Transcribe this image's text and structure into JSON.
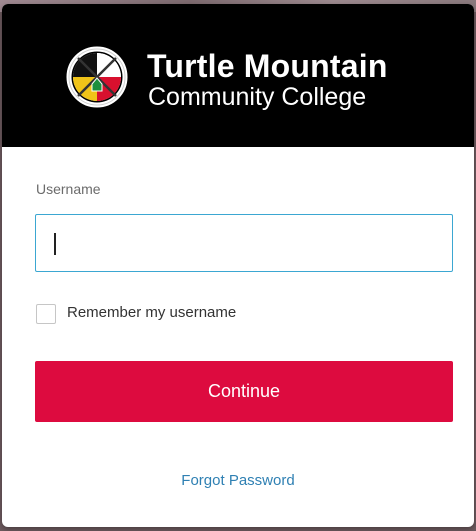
{
  "header": {
    "brand_line1": "Turtle Mountain",
    "brand_line2": "Community College",
    "logo_icon": "tmcc-medicine-wheel-logo"
  },
  "form": {
    "username_label": "Username",
    "username_value": "",
    "remember_label": "Remember my username",
    "remember_checked": false,
    "continue_label": "Continue",
    "forgot_label": "Forgot Password"
  },
  "colors": {
    "header_bg": "#000000",
    "primary_button": "#dd0b3f",
    "focus_border": "#3ba7d2",
    "link": "#2f80b3"
  }
}
